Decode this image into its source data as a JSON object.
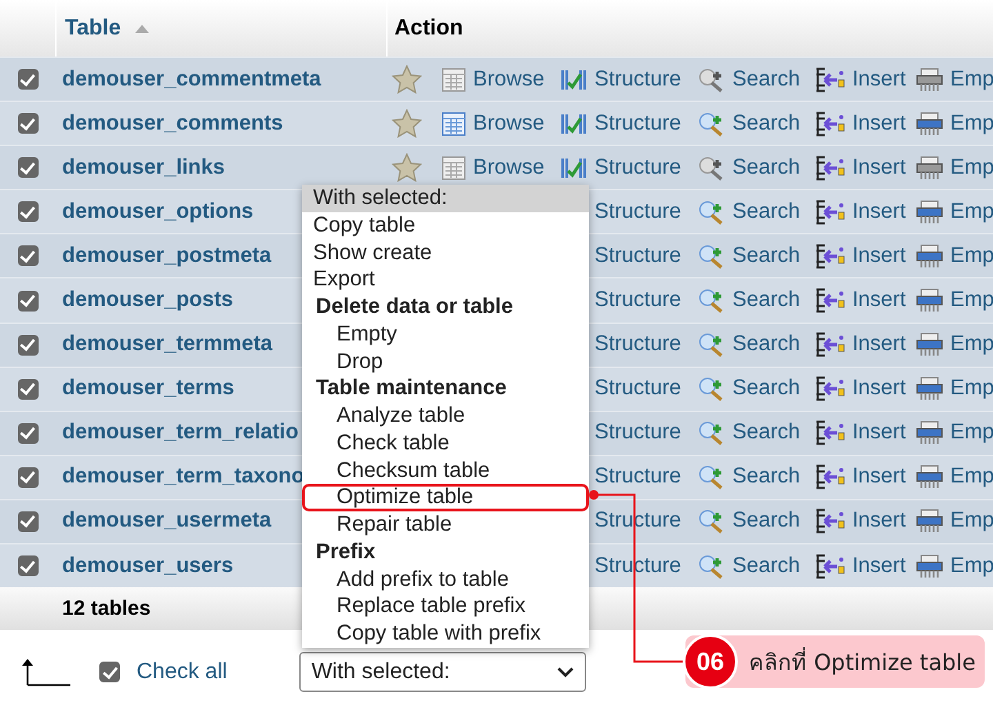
{
  "table": {
    "columns": [
      {
        "label": "Table"
      },
      {
        "label": "Action"
      }
    ],
    "rows": [
      {
        "name": "demouser_commentmeta",
        "checked": true,
        "actions": [
          {
            "kind": "favorite"
          },
          {
            "kind": "browse",
            "label": "Browse",
            "disabled": true
          },
          {
            "kind": "structure",
            "label": "Structure"
          },
          {
            "kind": "search",
            "label": "Search",
            "disabled": true
          },
          {
            "kind": "insert",
            "label": "Insert"
          },
          {
            "kind": "empty",
            "label": "Emp",
            "disabled": true
          }
        ]
      },
      {
        "name": "demouser_comments",
        "checked": true,
        "actions": [
          {
            "kind": "favorite"
          },
          {
            "kind": "browse",
            "label": "Browse",
            "disabled": false
          },
          {
            "kind": "structure",
            "label": "Structure"
          },
          {
            "kind": "search",
            "label": "Search",
            "disabled": false
          },
          {
            "kind": "insert",
            "label": "Insert"
          },
          {
            "kind": "empty",
            "label": "Emp",
            "disabled": false
          }
        ]
      },
      {
        "name": "demouser_links",
        "checked": true,
        "actions": [
          {
            "kind": "favorite"
          },
          {
            "kind": "browse",
            "label": "Browse",
            "disabled": true
          },
          {
            "kind": "structure",
            "label": "Structure"
          },
          {
            "kind": "search",
            "label": "Search",
            "disabled": true
          },
          {
            "kind": "insert",
            "label": "Insert"
          },
          {
            "kind": "empty",
            "label": "Emp",
            "disabled": true
          }
        ]
      },
      {
        "name": "demouser_options",
        "checked": true,
        "actions": [
          {
            "kind": "structure",
            "label": "Structure"
          },
          {
            "kind": "search",
            "label": "Search",
            "disabled": false
          },
          {
            "kind": "insert",
            "label": "Insert"
          },
          {
            "kind": "empty",
            "label": "Emp",
            "disabled": false
          }
        ]
      },
      {
        "name": "demouser_postmeta",
        "checked": true,
        "actions": [
          {
            "kind": "structure",
            "label": "Structure"
          },
          {
            "kind": "search",
            "label": "Search",
            "disabled": false
          },
          {
            "kind": "insert",
            "label": "Insert"
          },
          {
            "kind": "empty",
            "label": "Emp",
            "disabled": false
          }
        ]
      },
      {
        "name": "demouser_posts",
        "checked": true,
        "actions": [
          {
            "kind": "structure",
            "label": "Structure"
          },
          {
            "kind": "search",
            "label": "Search",
            "disabled": false
          },
          {
            "kind": "insert",
            "label": "Insert"
          },
          {
            "kind": "empty",
            "label": "Emp",
            "disabled": false
          }
        ]
      },
      {
        "name": "demouser_termmeta",
        "checked": true,
        "actions": [
          {
            "kind": "structure",
            "label": "Structure"
          },
          {
            "kind": "search",
            "label": "Search",
            "disabled": false
          },
          {
            "kind": "insert",
            "label": "Insert"
          },
          {
            "kind": "empty",
            "label": "Emp",
            "disabled": false
          }
        ]
      },
      {
        "name": "demouser_terms",
        "checked": true,
        "actions": [
          {
            "kind": "structure",
            "label": "Structure"
          },
          {
            "kind": "search",
            "label": "Search",
            "disabled": false
          },
          {
            "kind": "insert",
            "label": "Insert"
          },
          {
            "kind": "empty",
            "label": "Emp",
            "disabled": false
          }
        ]
      },
      {
        "name": "demouser_term_relatio",
        "checked": true,
        "actions": [
          {
            "kind": "structure",
            "label": "Structure"
          },
          {
            "kind": "search",
            "label": "Search",
            "disabled": false
          },
          {
            "kind": "insert",
            "label": "Insert"
          },
          {
            "kind": "empty",
            "label": "Emp",
            "disabled": false
          }
        ]
      },
      {
        "name": "demouser_term_taxono",
        "checked": true,
        "actions": [
          {
            "kind": "structure",
            "label": "Structure"
          },
          {
            "kind": "search",
            "label": "Search",
            "disabled": false
          },
          {
            "kind": "insert",
            "label": "Insert"
          },
          {
            "kind": "empty",
            "label": "Emp",
            "disabled": false
          }
        ]
      },
      {
        "name": "demouser_usermeta",
        "checked": true,
        "actions": [
          {
            "kind": "structure",
            "label": "Structure"
          },
          {
            "kind": "search",
            "label": "Search",
            "disabled": false
          },
          {
            "kind": "insert",
            "label": "Insert"
          },
          {
            "kind": "empty",
            "label": "Emp",
            "disabled": false
          }
        ]
      },
      {
        "name": "demouser_users",
        "checked": true,
        "actions": [
          {
            "kind": "structure",
            "label": "Structure"
          },
          {
            "kind": "search",
            "label": "Search",
            "disabled": false
          },
          {
            "kind": "insert",
            "label": "Insert"
          },
          {
            "kind": "empty",
            "label": "Emp",
            "disabled": false
          }
        ]
      }
    ],
    "footer": "12 tables"
  },
  "bulk": {
    "check_all": {
      "label": "Check all",
      "checked": true
    },
    "select": {
      "value": "With selected:"
    }
  },
  "dropdown": {
    "items": [
      {
        "kind": "option",
        "label": "With selected:",
        "selected": true,
        "annotated": false
      },
      {
        "kind": "option",
        "label": "Copy table",
        "selected": false,
        "annotated": false
      },
      {
        "kind": "option",
        "label": "Show create",
        "selected": false,
        "annotated": false
      },
      {
        "kind": "option",
        "label": "Export",
        "selected": false,
        "annotated": false
      },
      {
        "kind": "group",
        "label": "Delete data or table",
        "children": [
          {
            "kind": "option",
            "label": "Empty",
            "selected": false,
            "annotated": false
          },
          {
            "kind": "option",
            "label": "Drop",
            "selected": false,
            "annotated": false
          }
        ]
      },
      {
        "kind": "group",
        "label": "Table maintenance",
        "children": [
          {
            "kind": "option",
            "label": "Analyze table",
            "selected": false,
            "annotated": false
          },
          {
            "kind": "option",
            "label": "Check table",
            "selected": false,
            "annotated": false
          },
          {
            "kind": "option",
            "label": "Checksum table",
            "selected": false,
            "annotated": false
          },
          {
            "kind": "option",
            "label": "Optimize table",
            "selected": false,
            "annotated": true
          },
          {
            "kind": "option",
            "label": "Repair table",
            "selected": false,
            "annotated": false
          }
        ]
      },
      {
        "kind": "group",
        "label": "Prefix",
        "children": [
          {
            "kind": "option",
            "label": "Add prefix to table",
            "selected": false,
            "annotated": false
          },
          {
            "kind": "option",
            "label": "Replace table prefix",
            "selected": false,
            "annotated": false
          },
          {
            "kind": "option",
            "label": "Copy table with prefix",
            "selected": false,
            "annotated": false
          }
        ]
      }
    ]
  },
  "callout": {
    "step": "06",
    "text": "คลิกที่ Optimize table"
  }
}
